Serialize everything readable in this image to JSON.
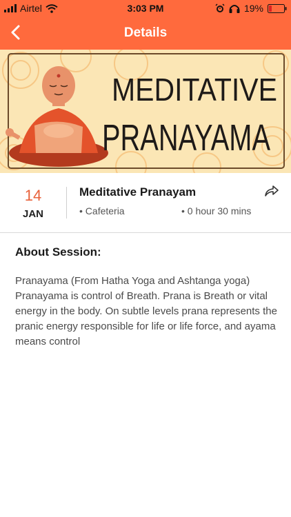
{
  "status_bar": {
    "carrier": "Airtel",
    "time": "3:03 PM",
    "battery": "19%",
    "battery_level": 0.19
  },
  "header": {
    "title": "Details",
    "back_icon": "chevron-left-icon"
  },
  "banner": {
    "line1": "MEDITATIVE",
    "line2": "PRANAYAMA"
  },
  "session": {
    "day": "14",
    "month": "JAN",
    "title": "Meditative Pranayam",
    "venue": "• Cafeteria",
    "duration": "• 0 hour 30 mins",
    "share_icon": "share-icon"
  },
  "about": {
    "heading": "About Session:",
    "text": "Pranayama (From Hatha Yoga and Ashtanga yoga) Pranayama is control of Breath. Prana is Breath or vital energy in the body. On subtle levels prana represents the pranic energy responsible for life or life force, and ayama means control"
  },
  "colors": {
    "accent": "#ff6a3d",
    "date_accent": "#e8613a",
    "banner_bg": "#fbe6b5"
  }
}
